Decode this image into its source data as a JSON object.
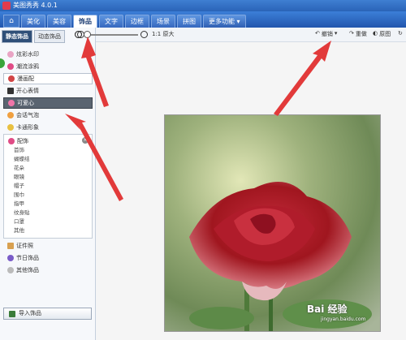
{
  "titlebar": {
    "title": "美图秀秀 4.0.1"
  },
  "nav": {
    "tabs": [
      "美化",
      "美容",
      "饰品",
      "文字",
      "边框",
      "场景",
      "拼图"
    ],
    "more": "更多功能 ▾",
    "active_index": 2
  },
  "left": {
    "subtabs": [
      "静态饰品",
      "动态饰品"
    ],
    "items_top": [
      "炫彩水印",
      "潮流涂鸦",
      "漫画配"
    ],
    "items_mid": [
      "开心表情",
      "可爱心",
      "会话气泡",
      "卡通形象"
    ],
    "group_title": "配饰",
    "group_items": [
      "首饰",
      "蝴蝶结",
      "花朵",
      "眼镜",
      "帽子",
      "围巾",
      "指甲",
      "纹身贴",
      "口罩",
      "其他"
    ],
    "items_bottom": [
      "证件照",
      "节日饰品",
      "其他饰品"
    ],
    "import_label": "导入饰品"
  },
  "toolbar": {
    "original_size": "1:1 原大",
    "undo": "撤销",
    "redo": "重做",
    "original_image": "原图",
    "zoom_percent": 0.05
  },
  "watermark": {
    "main": "Bai 经验",
    "sub": "jingyan.baidu.com"
  },
  "colors": {
    "accent": "#2a63b7",
    "arrow": "#e03030"
  }
}
